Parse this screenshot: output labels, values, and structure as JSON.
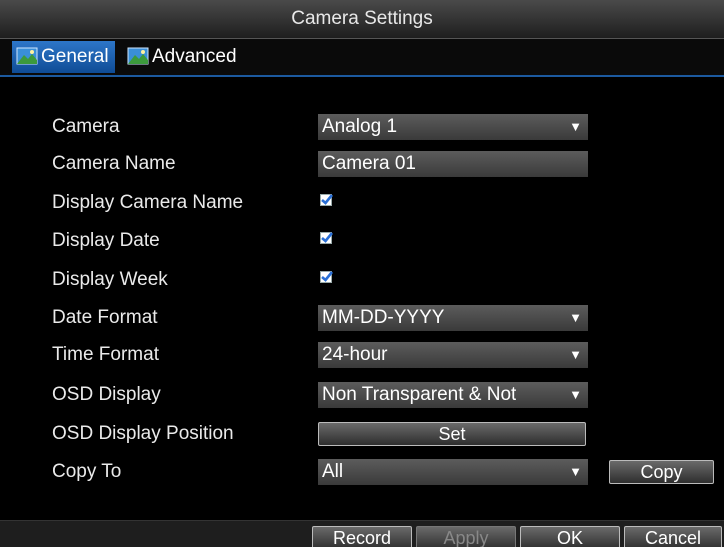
{
  "window": {
    "title": "Camera Settings"
  },
  "tabs": [
    {
      "label": "General",
      "icon": "landscape-icon",
      "active": true
    },
    {
      "label": "Advanced",
      "icon": "landscape-icon",
      "active": false
    }
  ],
  "form": {
    "camera": {
      "label": "Camera",
      "value": "Analog 1"
    },
    "camera_name": {
      "label": "Camera Name",
      "value": "Camera 01"
    },
    "display_camera_name": {
      "label": "Display Camera Name",
      "checked": true
    },
    "display_date": {
      "label": "Display Date",
      "checked": true
    },
    "display_week": {
      "label": "Display Week",
      "checked": true
    },
    "date_format": {
      "label": "Date Format",
      "value": "MM-DD-YYYY"
    },
    "time_format": {
      "label": "Time Format",
      "value": "24-hour"
    },
    "osd_display": {
      "label": "OSD Display",
      "value": "Non Transparent & Not"
    },
    "osd_position": {
      "label": "OSD Display Position",
      "button": "Set"
    },
    "copy_to": {
      "label": "Copy To",
      "value": "All",
      "button": "Copy"
    }
  },
  "footer": {
    "record": "Record",
    "apply": "Apply",
    "ok": "OK",
    "cancel": "Cancel"
  },
  "colors": {
    "accent": "#1c5aa0",
    "tab_active": "#2d76c8",
    "field_bg": "#4a4a4a",
    "checkbox_mark": "#2a6fd6"
  }
}
